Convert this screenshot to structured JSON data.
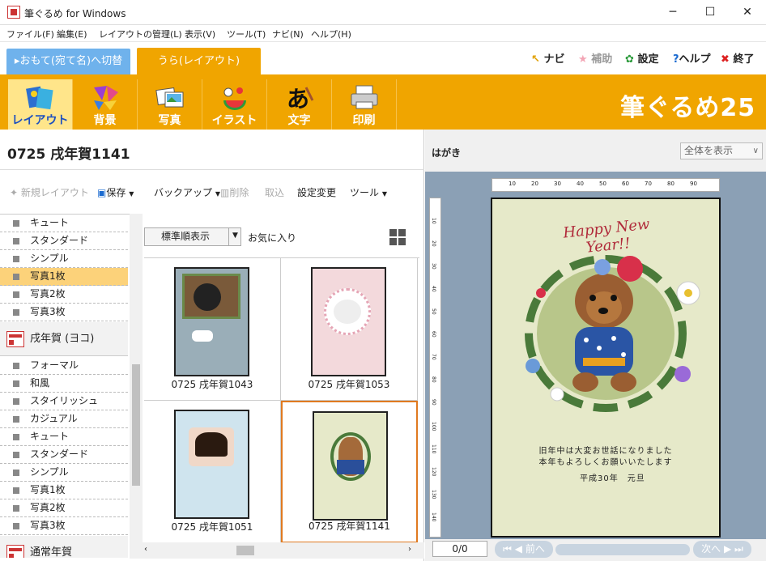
{
  "window": {
    "title": "筆ぐるめ for Windows",
    "minimize": "─",
    "maximize": "☐",
    "close": "✕"
  },
  "menu": [
    "ファイル(F)",
    "編集(E)",
    "レイアウトの管理(L)",
    "表示(V)",
    "ツール(T)",
    "ナビ(N)",
    "ヘルプ(H)"
  ],
  "mode_tabs": {
    "omote": "▸おもて(宛て名)へ切替",
    "ura": "うら(レイアウト)"
  },
  "top_links": {
    "navi": "ナビ",
    "hojo": "補助",
    "settei": "設定",
    "help": "ヘルプ",
    "exit": "終了"
  },
  "ribbon": [
    "レイアウト",
    "背景",
    "写真",
    "イラスト",
    "文字",
    "印刷"
  ],
  "brand": "筆ぐるめ25",
  "doc_title": "0725 戌年賀1141",
  "toolbar": {
    "new": "新規レイアウト",
    "save": "保存",
    "backup": "バックアップ",
    "delete": "削除",
    "import": "取込",
    "settings_change": "設定変更",
    "tools": "ツール"
  },
  "categories_top": [
    "キュート",
    "スタンダード",
    "シンプル",
    "写真1枚",
    "写真2枚",
    "写真3枚"
  ],
  "category_header_1": "戌年賀 (ヨコ)",
  "categories_mid": [
    "フォーマル",
    "和風",
    "スタイリッシュ",
    "カジュアル",
    "キュート",
    "スタンダード",
    "シンプル",
    "写真1枚",
    "写真2枚",
    "写真3枚"
  ],
  "category_header_2": "通常年賀",
  "sort": {
    "selected": "標準順表示",
    "favorites": "お気に入り"
  },
  "thumbnails": [
    {
      "caption": "0725 戌年賀1043"
    },
    {
      "caption": "0725 戌年賀1053"
    },
    {
      "caption": "0725 戌年賀1051"
    },
    {
      "caption": "0725 戌年賀1141"
    }
  ],
  "preview": {
    "label": "はがき",
    "zoom": "全体を表示",
    "ruler_top": [
      "10",
      "20",
      "30",
      "40",
      "50",
      "60",
      "70",
      "80",
      "90"
    ],
    "ruler_left": [
      "10",
      "20",
      "30",
      "40",
      "50",
      "60",
      "70",
      "80",
      "90",
      "100",
      "110",
      "120",
      "130",
      "140"
    ],
    "card_heading": "Happy New Year!!",
    "card_line1": "旧年中は大変お世話になりました",
    "card_line2": "本年もよろしくお願いいたします",
    "card_date": "平成30年　元旦",
    "page": "0/0",
    "prev": "前へ",
    "next": "次へ"
  }
}
